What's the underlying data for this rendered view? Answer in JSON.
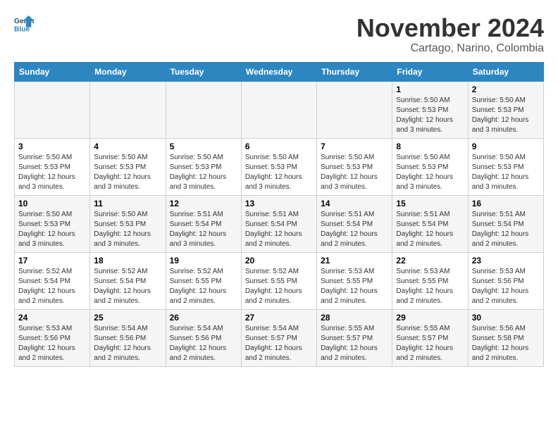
{
  "logo": {
    "line1": "General",
    "line2": "Blue"
  },
  "title": "November 2024",
  "subtitle": "Cartago, Narino, Colombia",
  "weekdays": [
    "Sunday",
    "Monday",
    "Tuesday",
    "Wednesday",
    "Thursday",
    "Friday",
    "Saturday"
  ],
  "weeks": [
    [
      {
        "day": "",
        "info": ""
      },
      {
        "day": "",
        "info": ""
      },
      {
        "day": "",
        "info": ""
      },
      {
        "day": "",
        "info": ""
      },
      {
        "day": "",
        "info": ""
      },
      {
        "day": "1",
        "info": "Sunrise: 5:50 AM\nSunset: 5:53 PM\nDaylight: 12 hours\nand 3 minutes."
      },
      {
        "day": "2",
        "info": "Sunrise: 5:50 AM\nSunset: 5:53 PM\nDaylight: 12 hours\nand 3 minutes."
      }
    ],
    [
      {
        "day": "3",
        "info": "Sunrise: 5:50 AM\nSunset: 5:53 PM\nDaylight: 12 hours\nand 3 minutes."
      },
      {
        "day": "4",
        "info": "Sunrise: 5:50 AM\nSunset: 5:53 PM\nDaylight: 12 hours\nand 3 minutes."
      },
      {
        "day": "5",
        "info": "Sunrise: 5:50 AM\nSunset: 5:53 PM\nDaylight: 12 hours\nand 3 minutes."
      },
      {
        "day": "6",
        "info": "Sunrise: 5:50 AM\nSunset: 5:53 PM\nDaylight: 12 hours\nand 3 minutes."
      },
      {
        "day": "7",
        "info": "Sunrise: 5:50 AM\nSunset: 5:53 PM\nDaylight: 12 hours\nand 3 minutes."
      },
      {
        "day": "8",
        "info": "Sunrise: 5:50 AM\nSunset: 5:53 PM\nDaylight: 12 hours\nand 3 minutes."
      },
      {
        "day": "9",
        "info": "Sunrise: 5:50 AM\nSunset: 5:53 PM\nDaylight: 12 hours\nand 3 minutes."
      }
    ],
    [
      {
        "day": "10",
        "info": "Sunrise: 5:50 AM\nSunset: 5:53 PM\nDaylight: 12 hours\nand 3 minutes."
      },
      {
        "day": "11",
        "info": "Sunrise: 5:50 AM\nSunset: 5:53 PM\nDaylight: 12 hours\nand 3 minutes."
      },
      {
        "day": "12",
        "info": "Sunrise: 5:51 AM\nSunset: 5:54 PM\nDaylight: 12 hours\nand 3 minutes."
      },
      {
        "day": "13",
        "info": "Sunrise: 5:51 AM\nSunset: 5:54 PM\nDaylight: 12 hours\nand 2 minutes."
      },
      {
        "day": "14",
        "info": "Sunrise: 5:51 AM\nSunset: 5:54 PM\nDaylight: 12 hours\nand 2 minutes."
      },
      {
        "day": "15",
        "info": "Sunrise: 5:51 AM\nSunset: 5:54 PM\nDaylight: 12 hours\nand 2 minutes."
      },
      {
        "day": "16",
        "info": "Sunrise: 5:51 AM\nSunset: 5:54 PM\nDaylight: 12 hours\nand 2 minutes."
      }
    ],
    [
      {
        "day": "17",
        "info": "Sunrise: 5:52 AM\nSunset: 5:54 PM\nDaylight: 12 hours\nand 2 minutes."
      },
      {
        "day": "18",
        "info": "Sunrise: 5:52 AM\nSunset: 5:54 PM\nDaylight: 12 hours\nand 2 minutes."
      },
      {
        "day": "19",
        "info": "Sunrise: 5:52 AM\nSunset: 5:55 PM\nDaylight: 12 hours\nand 2 minutes."
      },
      {
        "day": "20",
        "info": "Sunrise: 5:52 AM\nSunset: 5:55 PM\nDaylight: 12 hours\nand 2 minutes."
      },
      {
        "day": "21",
        "info": "Sunrise: 5:53 AM\nSunset: 5:55 PM\nDaylight: 12 hours\nand 2 minutes."
      },
      {
        "day": "22",
        "info": "Sunrise: 5:53 AM\nSunset: 5:55 PM\nDaylight: 12 hours\nand 2 minutes."
      },
      {
        "day": "23",
        "info": "Sunrise: 5:53 AM\nSunset: 5:56 PM\nDaylight: 12 hours\nand 2 minutes."
      }
    ],
    [
      {
        "day": "24",
        "info": "Sunrise: 5:53 AM\nSunset: 5:56 PM\nDaylight: 12 hours\nand 2 minutes."
      },
      {
        "day": "25",
        "info": "Sunrise: 5:54 AM\nSunset: 5:56 PM\nDaylight: 12 hours\nand 2 minutes."
      },
      {
        "day": "26",
        "info": "Sunrise: 5:54 AM\nSunset: 5:56 PM\nDaylight: 12 hours\nand 2 minutes."
      },
      {
        "day": "27",
        "info": "Sunrise: 5:54 AM\nSunset: 5:57 PM\nDaylight: 12 hours\nand 2 minutes."
      },
      {
        "day": "28",
        "info": "Sunrise: 5:55 AM\nSunset: 5:57 PM\nDaylight: 12 hours\nand 2 minutes."
      },
      {
        "day": "29",
        "info": "Sunrise: 5:55 AM\nSunset: 5:57 PM\nDaylight: 12 hours\nand 2 minutes."
      },
      {
        "day": "30",
        "info": "Sunrise: 5:56 AM\nSunset: 5:58 PM\nDaylight: 12 hours\nand 2 minutes."
      }
    ]
  ]
}
